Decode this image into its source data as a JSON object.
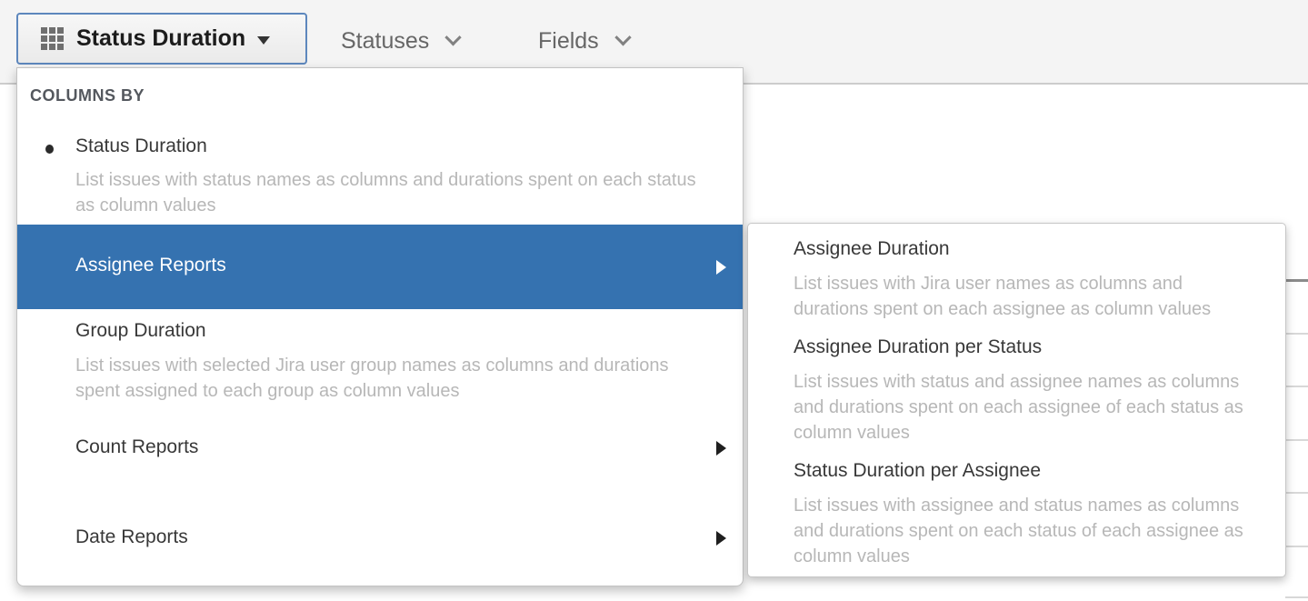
{
  "toolbar": {
    "report_button": {
      "label": "Status Duration",
      "grid_icon": "grid-icon",
      "caret_icon": "caret-down-icon"
    },
    "menus": [
      {
        "label": "Statuses",
        "chevron_icon": "chevron-down-icon"
      },
      {
        "label": "Fields",
        "chevron_icon": "chevron-down-icon"
      }
    ]
  },
  "dropdown": {
    "section_label": "COLUMNS BY",
    "items": [
      {
        "label": "Status Duration",
        "selected": true,
        "description": "List issues with status names as columns and durations spent on each status as column values"
      },
      {
        "label": "Assignee Reports",
        "highlighted": true,
        "has_submenu": true
      },
      {
        "label": "Group Duration",
        "description": "List issues with selected Jira user group names as columns and durations spent assigned to each group as column values"
      },
      {
        "label": "Count Reports",
        "has_submenu": true
      },
      {
        "label": "Date Reports",
        "has_submenu": true
      }
    ]
  },
  "submenu": {
    "items": [
      {
        "label": "Assignee Duration",
        "description": "List issues with Jira user names as columns and durations spent on each assignee as column values"
      },
      {
        "label": "Assignee Duration per Status",
        "description": "List issues with status and assignee names as columns and durations spent on each assignee of each status as column values"
      },
      {
        "label": "Status Duration per Assignee",
        "description": "List issues with assignee and status names as columns and durations spent on each status of each assignee as column values"
      }
    ]
  },
  "colors": {
    "highlight_blue": "#3572b0",
    "toolbar_background": "#f4f4f4",
    "button_border_blue": "#5d87bd",
    "description_gray": "#b7b7b7"
  }
}
